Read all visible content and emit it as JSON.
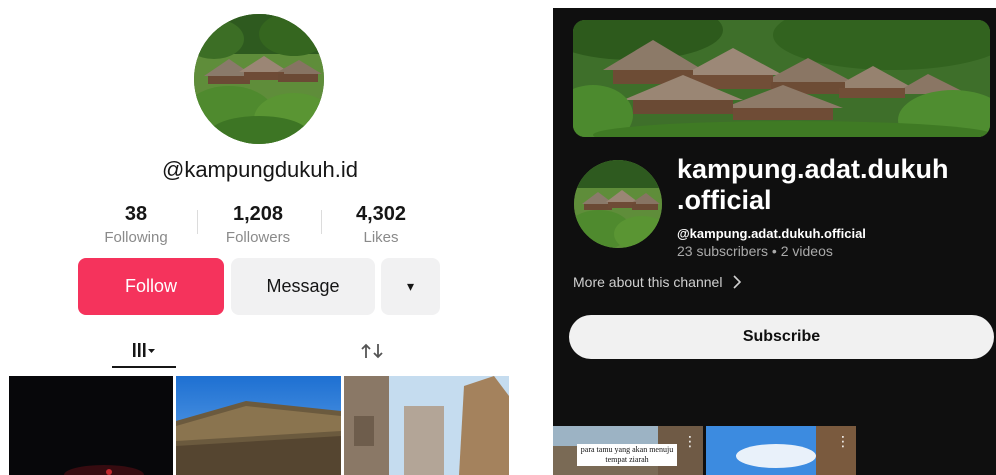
{
  "tiktok": {
    "username": "@kampungdukuh.id",
    "stats": [
      {
        "value": "38",
        "label": "Following"
      },
      {
        "value": "1,208",
        "label": "Followers"
      },
      {
        "value": "4,302",
        "label": "Likes"
      }
    ],
    "buttons": {
      "follow": "Follow",
      "message": "Message",
      "more": "▾"
    },
    "tabs": {
      "videos_icon": "grid-icon",
      "repost_icon": "repost-icon"
    },
    "colors": {
      "follow": "#f5335c",
      "secondary_button": "#f1f1f2"
    }
  },
  "youtube": {
    "channel_name_line1": "kampung.adat.dukuh",
    "channel_name_line2": ".official",
    "handle": "@kampung.adat.dukuh.official",
    "meta": "23 subscribers • 2 videos",
    "more_about": "More about this channel",
    "subscribe": "Subscribe",
    "thumb_caption": "para tamu yang akan menuju tempat ziarah",
    "colors": {
      "background": "#0f0f0f",
      "subscribe_button": "#f1f1f1"
    }
  }
}
